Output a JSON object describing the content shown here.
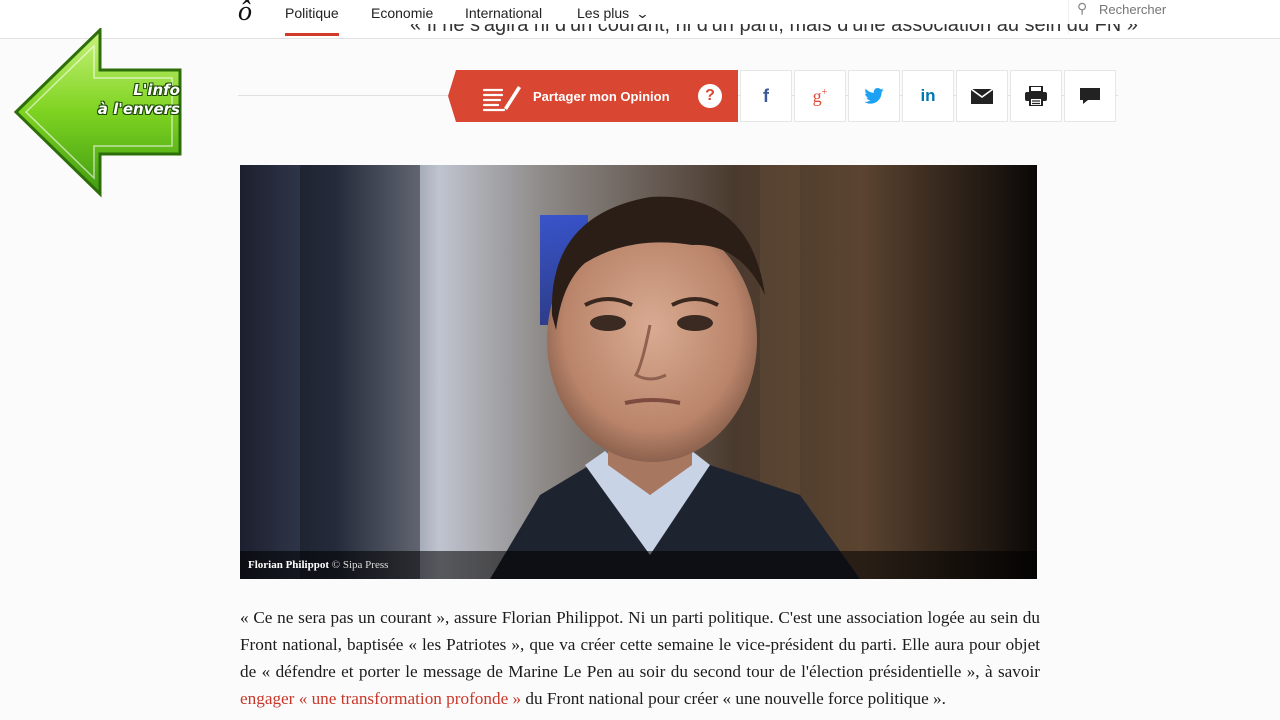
{
  "nav": {
    "logo": "ô",
    "items": [
      "Politique",
      "Economie",
      "International",
      "Les plus"
    ],
    "search_placeholder": "Rechercher"
  },
  "subtitle_fragment": "« Il ne s'agira ni d'un courant, ni d'un parti, mais d'une association au sein du FN »",
  "share": {
    "opinion_label": "Partager mon Opinion",
    "help": "?",
    "buttons": [
      "facebook-icon",
      "google-plus-icon",
      "twitter-icon",
      "linkedin-icon",
      "mail-icon",
      "print-icon",
      "comment-icon"
    ]
  },
  "photo": {
    "caption_name": "Florian Philippot",
    "caption_credit": "© Sipa Press"
  },
  "article": {
    "text_before_link": "« Ce ne sera pas un courant », assure Florian Philippot. Ni un parti politique. C'est une association logée au sein du Front national, baptisée « les Patriotes », que va créer cette semaine le vice-président du parti. Elle aura pour objet de « défendre et porter le message de Marine Le Pen au soir du second tour de l'élection présidentielle », à savoir ",
    "link_text": "engager « une transformation profonde »",
    "text_after_link": " du Front national pour créer « une nouvelle force politique »."
  },
  "overlay": {
    "line1": "L'info",
    "line2": "à l'envers"
  },
  "colors": {
    "accent_red": "#d94732",
    "facebook": "#3b5998",
    "google_plus": "#dd4b39",
    "twitter": "#1da1f2",
    "linkedin": "#0077b5",
    "arrow_green": "#7ed321"
  }
}
